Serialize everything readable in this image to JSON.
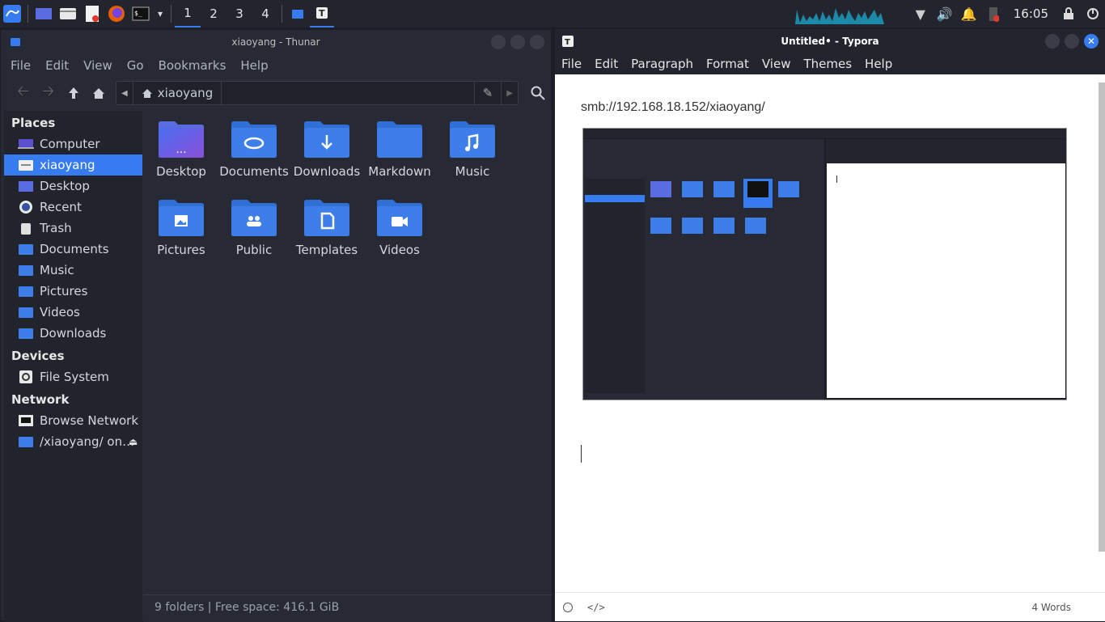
{
  "taskbar": {
    "workspaces": [
      "1",
      "2",
      "3",
      "4"
    ],
    "clock": "16:05"
  },
  "thunar": {
    "title": "xiaoyang - Thunar",
    "menu": [
      "File",
      "Edit",
      "View",
      "Go",
      "Bookmarks",
      "Help"
    ],
    "path": "xiaoyang",
    "sidebar": {
      "places_header": "Places",
      "places": [
        "Computer",
        "xiaoyang",
        "Desktop",
        "Recent",
        "Trash",
        "Documents",
        "Music",
        "Pictures",
        "Videos",
        "Downloads"
      ],
      "devices_header": "Devices",
      "devices": [
        "File System"
      ],
      "network_header": "Network",
      "network": [
        "Browse Network",
        "/xiaoyang/ on…"
      ]
    },
    "folders": [
      "Desktop",
      "Documents",
      "Downloads",
      "Markdown",
      "Music",
      "Pictures",
      "Public",
      "Templates",
      "Videos"
    ],
    "status": "9 folders  |  Free space: 416.1 GiB"
  },
  "typora": {
    "title": "Untitled• - Typora",
    "menu": [
      "File",
      "Edit",
      "Paragraph",
      "Format",
      "View",
      "Themes",
      "Help"
    ],
    "url_text": "smb://192.168.18.152/xiaoyang/",
    "word_count": "4 Words"
  },
  "colors": {
    "accent": "#367bf0",
    "folder": "#3d7ee8",
    "panel": "#272a34"
  }
}
